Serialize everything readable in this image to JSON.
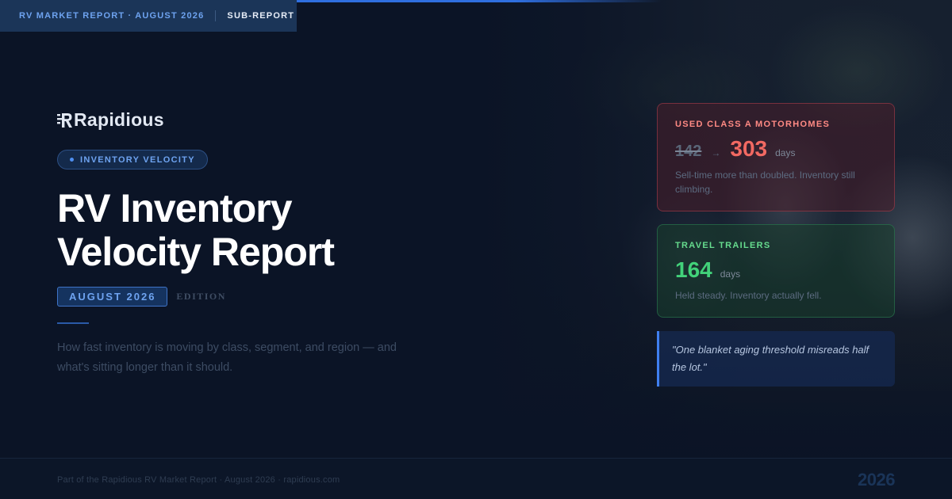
{
  "top_bar": {
    "crumb": "RV MARKET REPORT · AUGUST 2026",
    "sub_report": "SUB-REPORT"
  },
  "brand": {
    "name": "Rapidious"
  },
  "hero": {
    "badge": "INVENTORY VELOCITY",
    "title_line1": "RV Inventory",
    "title_line2": "Velocity Report",
    "edition_date": "AUGUST 2026",
    "edition_label": "EDITION",
    "subtitle": "How fast inventory is moving by class, segment, and region — and what's sitting longer than it should."
  },
  "cards": {
    "class_a": {
      "title": "USED CLASS A MOTORHOMES",
      "old_value": "142",
      "arrow": "→",
      "new_value": "303",
      "unit": "days",
      "description": "Sell-time more than doubled. Inventory still climbing."
    },
    "travel_trailers": {
      "title": "TRAVEL TRAILERS",
      "value": "164",
      "unit": "days",
      "description": "Held steady. Inventory actually fell."
    }
  },
  "quote": "\"One blanket aging threshold misreads half the lot.\"",
  "footer": {
    "text": "Part of the Rapidious RV Market Report · August 2026 · rapidious.com",
    "year": "2026"
  },
  "colors": {
    "background": "#0b1426",
    "accent_blue": "#2f6fe0",
    "negative_red": "#f26962",
    "positive_green": "#42d27a"
  },
  "icons": {
    "logo_mark": "speed-lines-r-icon",
    "badge_dot": "dot-icon"
  }
}
